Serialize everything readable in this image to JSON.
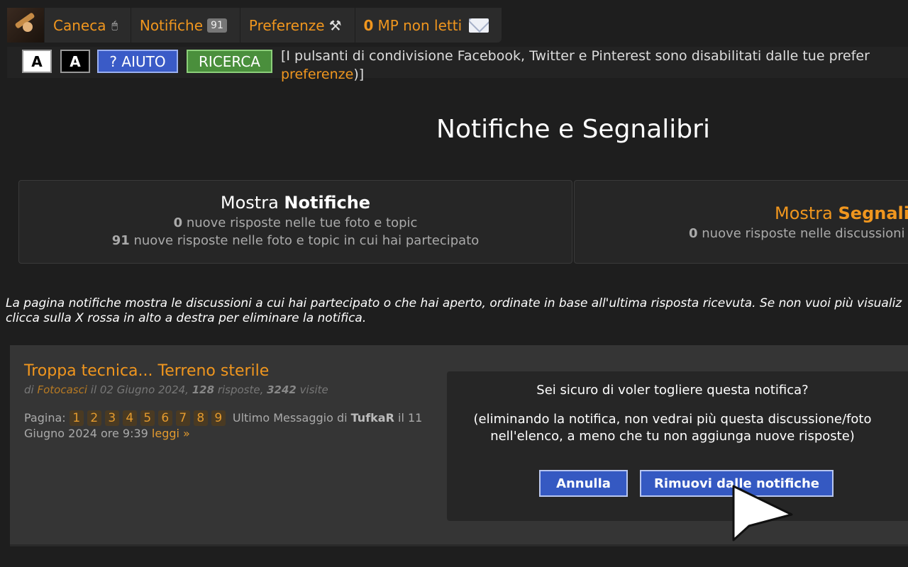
{
  "topnav": {
    "user": "Caneca",
    "notifications_label": "Notifiche",
    "notifications_count": "91",
    "preferences_label": "Preferenze",
    "pm_count": "0",
    "pm_label": "MP non letti"
  },
  "toolbar": {
    "font_light": "A",
    "font_dark": "A",
    "help_label": "? AIUTO",
    "search_label": "RICERCA",
    "share_note_prefix": "[I pulsanti di condivisione Facebook, Twitter e Pinterest sono disabilitati dalle tue prefer",
    "share_note_link": "preferenze",
    "share_note_suffix": ")]"
  },
  "page_title": "Notifiche e Segnalibri",
  "cards": {
    "notifiche": {
      "prefix": "Mostra ",
      "title": "Notifiche",
      "line1_count": "0",
      "line1_text": " nuove risposte nelle tue foto e topic",
      "line2_count": "91",
      "line2_text": " nuove risposte nelle foto e topic in cui hai partecipato"
    },
    "segnalibri": {
      "prefix": "Mostra ",
      "title": "Segnalib",
      "line1_count": "0",
      "line1_text": " nuove risposte nelle discussioni"
    }
  },
  "intro": {
    "line1": "La pagina notifiche mostra le discussioni a cui hai partecipato o che hai aperto, ordinate in base all'ultima risposta ricevuta. Se non vuoi più visualiz",
    "line2": "clicca sulla X rossa in alto a destra per eliminare la notifica."
  },
  "topic": {
    "title": "Troppa tecnica... Terreno sterile",
    "meta_di": "di ",
    "author": "Fotocasci",
    "meta_date": " il 02 Giugno 2024, ",
    "replies": "128",
    "replies_label": " risposte, ",
    "views": "3242",
    "views_label": " visite",
    "pages_label": "Pagina: ",
    "pages": [
      "1",
      "2",
      "3",
      "4",
      "5",
      "6",
      "7",
      "8",
      "9"
    ],
    "last_message_label": "Ultimo Messaggio di ",
    "last_author": "TufkaR",
    "last_date": " il 11 Giugno 2024 ore 9:39 ",
    "read_link": "leggi »"
  },
  "dialog": {
    "question": "Sei sicuro di voler togliere questa notifica?",
    "explanation_line1": "(eliminando la notifica, non vedrai più questa discussione/foto",
    "explanation_line2": "nell'elenco, a meno che tu non aggiunga nuove risposte)",
    "cancel_label": "Annulla",
    "confirm_label": "Rimuovi dalle notifiche"
  },
  "colors": {
    "accent": "#f0961e",
    "background": "#1e1e1e",
    "button_blue": "#3559c2",
    "button_green": "#4a8f3c"
  },
  "icons": {
    "avatar": "user-avatar",
    "status": "mouse-icon",
    "preferences": "tools-icon",
    "messages": "envelope-icon",
    "cursor": "mouse-cursor-icon"
  }
}
